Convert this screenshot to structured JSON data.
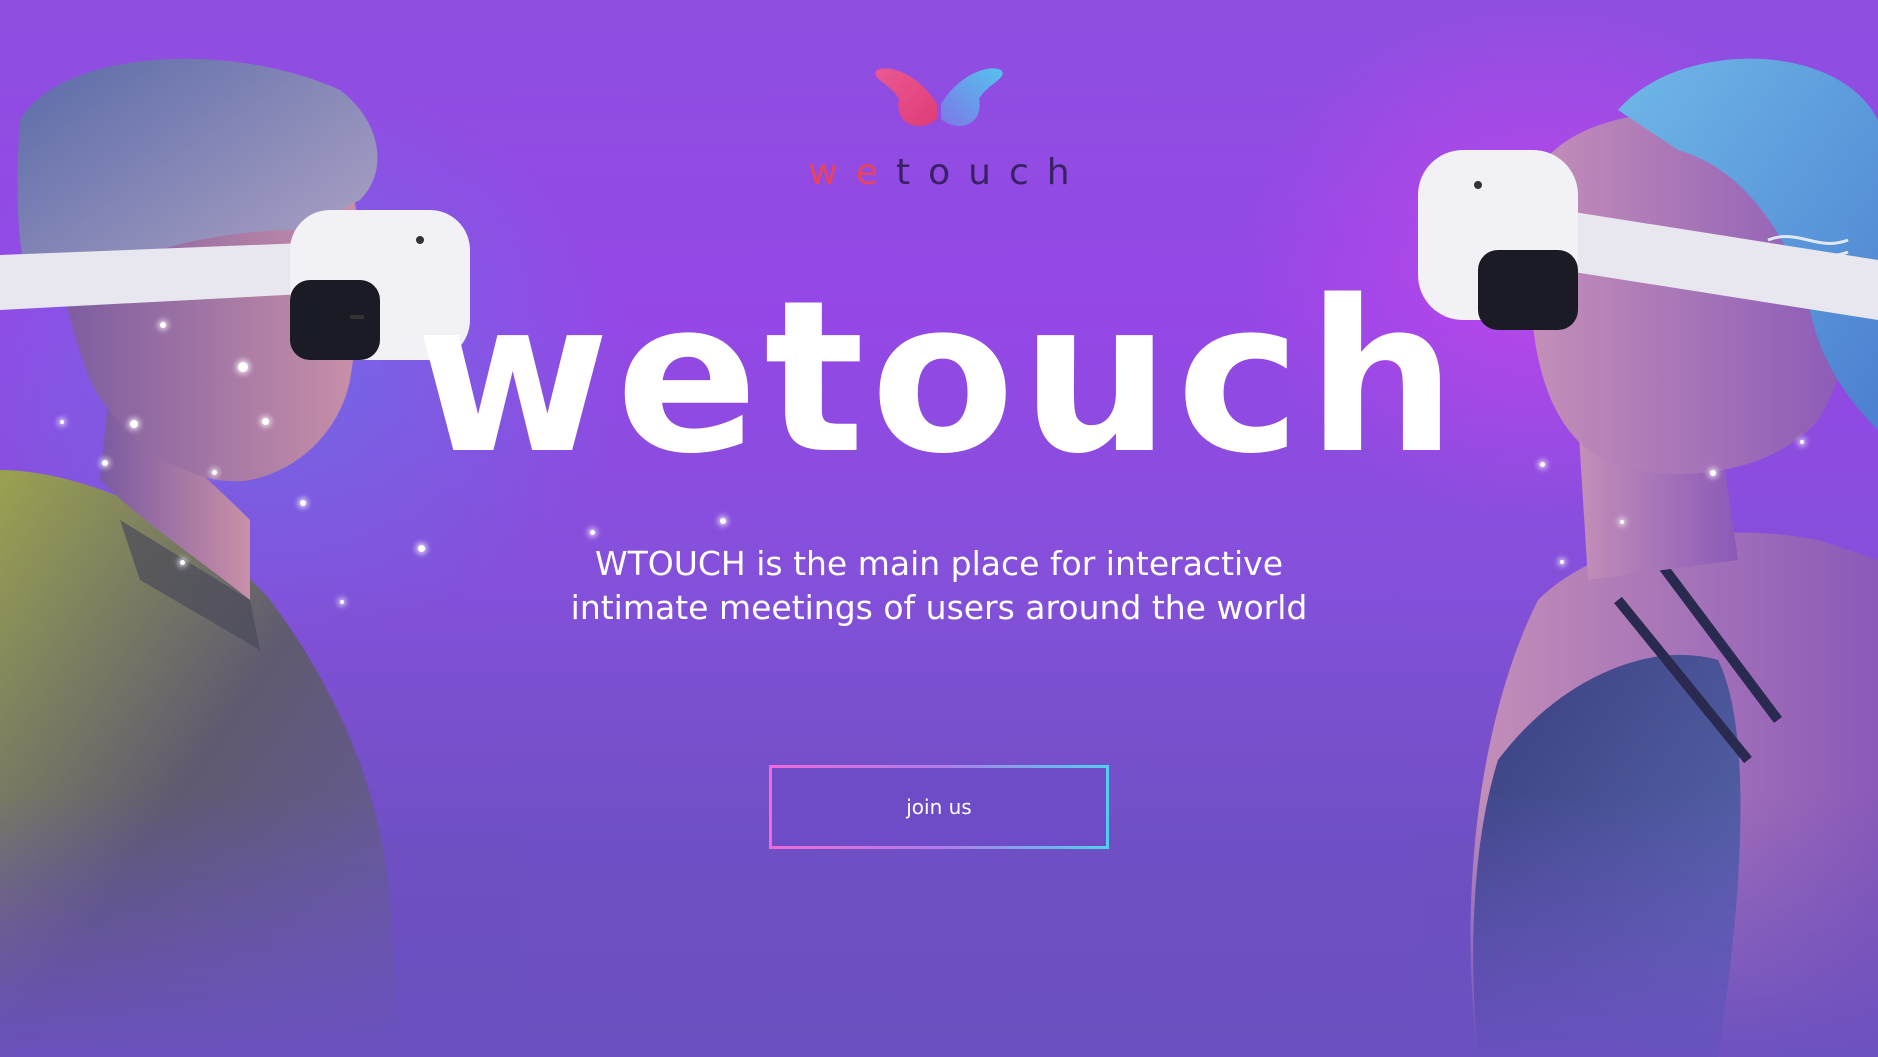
{
  "brand": {
    "logo_we": "we",
    "logo_touch": "touch",
    "colors": {
      "we": "#e8435f",
      "touch": "#3a2166",
      "background_top": "#9547e6",
      "background_bottom": "#6a50c0"
    }
  },
  "hero": {
    "title": "wetouch",
    "subtitle_line1": "WTOUCH is the main place for interactive",
    "subtitle_line2": "intimate meetings of users around the world"
  },
  "cta": {
    "label": "join us"
  },
  "icons": {
    "logo": "butterfly-logo-icon"
  }
}
